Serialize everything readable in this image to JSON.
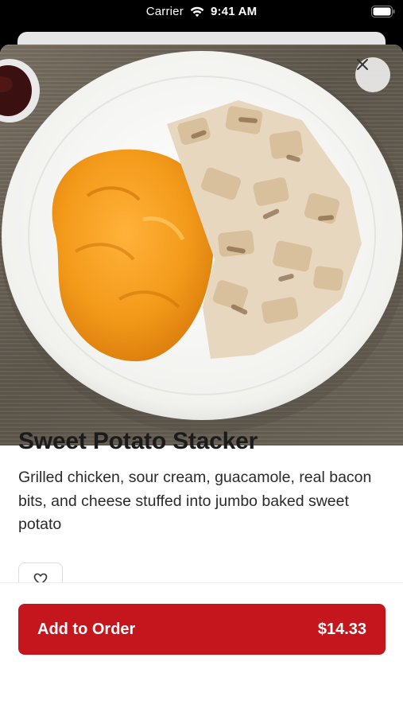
{
  "status_bar": {
    "carrier": "Carrier",
    "time": "9:41 AM",
    "icons": [
      "wifi-icon",
      "battery-icon"
    ]
  },
  "hero": {
    "close_icon": "close-icon"
  },
  "item": {
    "title": "Sweet Potato Stacker",
    "description": "Grilled chicken, sour cream, guacamole, real bacon bits, and cheese stuffed into jumbo baked sweet potato"
  },
  "favorite": {
    "icon": "heart-outline-icon"
  },
  "order_bar": {
    "add_label": "Add to Order",
    "price": "$14.33"
  },
  "colors": {
    "accent": "#c4161c",
    "status_bar": "#000000"
  }
}
